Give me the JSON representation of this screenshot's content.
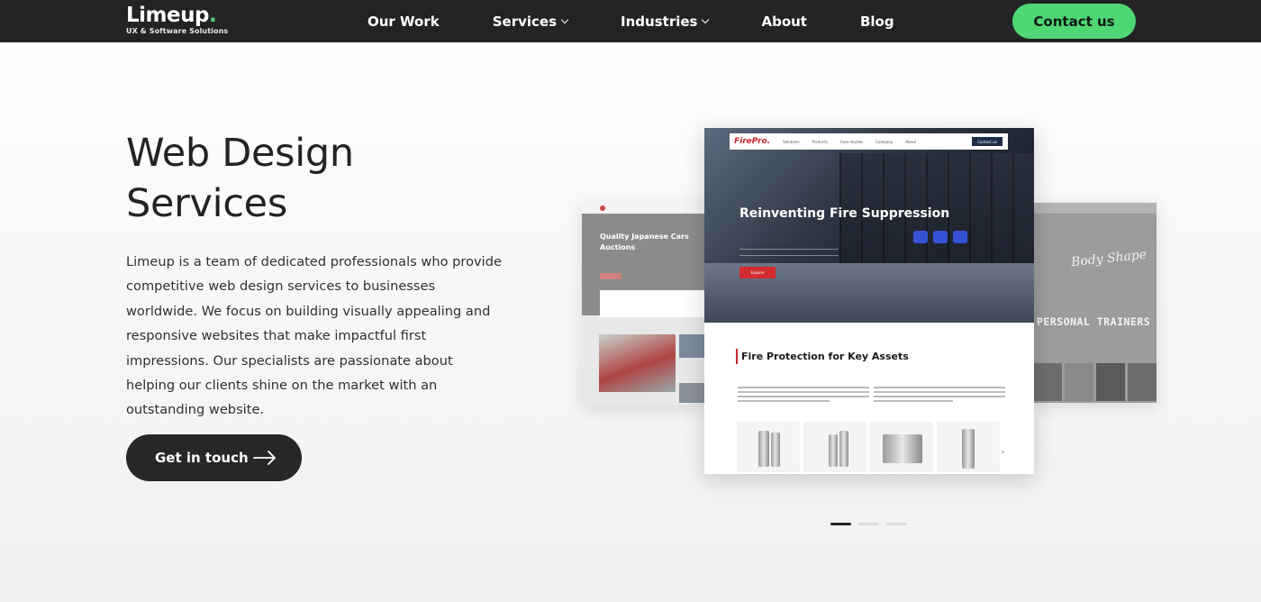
{
  "brand": {
    "logo_text": "Limeup",
    "logo_dot": ".",
    "tagline": "UX & Software Solutions"
  },
  "nav": {
    "items": [
      {
        "label": "Our Work",
        "dropdown": false
      },
      {
        "label": "Services",
        "dropdown": true
      },
      {
        "label": "Industries",
        "dropdown": true
      },
      {
        "label": "About",
        "dropdown": false
      },
      {
        "label": "Blog",
        "dropdown": false
      }
    ],
    "contact_label": "Contact us"
  },
  "hero": {
    "title": "Web Design Services",
    "description": "Limeup is a team of dedicated professionals who provide competitive web design services to businesses worldwide. We focus on building visually appealing and responsive websites that make impactful first impressions. Our specialists are passionate about helping our clients shine on the market with an outstanding website.",
    "cta_label": "Get in touch"
  },
  "showcase": {
    "left": {
      "title": "Quality Japanese Cars Auctions"
    },
    "main": {
      "brand": "FirePro.",
      "nav_links": [
        "Solutions",
        "Products",
        "Case studies",
        "Company",
        "About"
      ],
      "nav_button": "Contact us",
      "headline": "Reinventing Fire Suppression",
      "button": "Explore",
      "section_title": "Fire Protection for Key Assets"
    },
    "right": {
      "script": "Body Shape",
      "headline": "PERSONAL TRAINERS"
    }
  },
  "carousel": {
    "total": 3,
    "active": 1
  },
  "colors": {
    "nav_bg": "#232325",
    "accent_green": "#4fd675",
    "cta_bg": "#27272a",
    "firepro_red": "#c8262b"
  },
  "icons": {
    "cta_arrow": "arrow-right-icon",
    "dropdown": "chevron-down-icon"
  }
}
